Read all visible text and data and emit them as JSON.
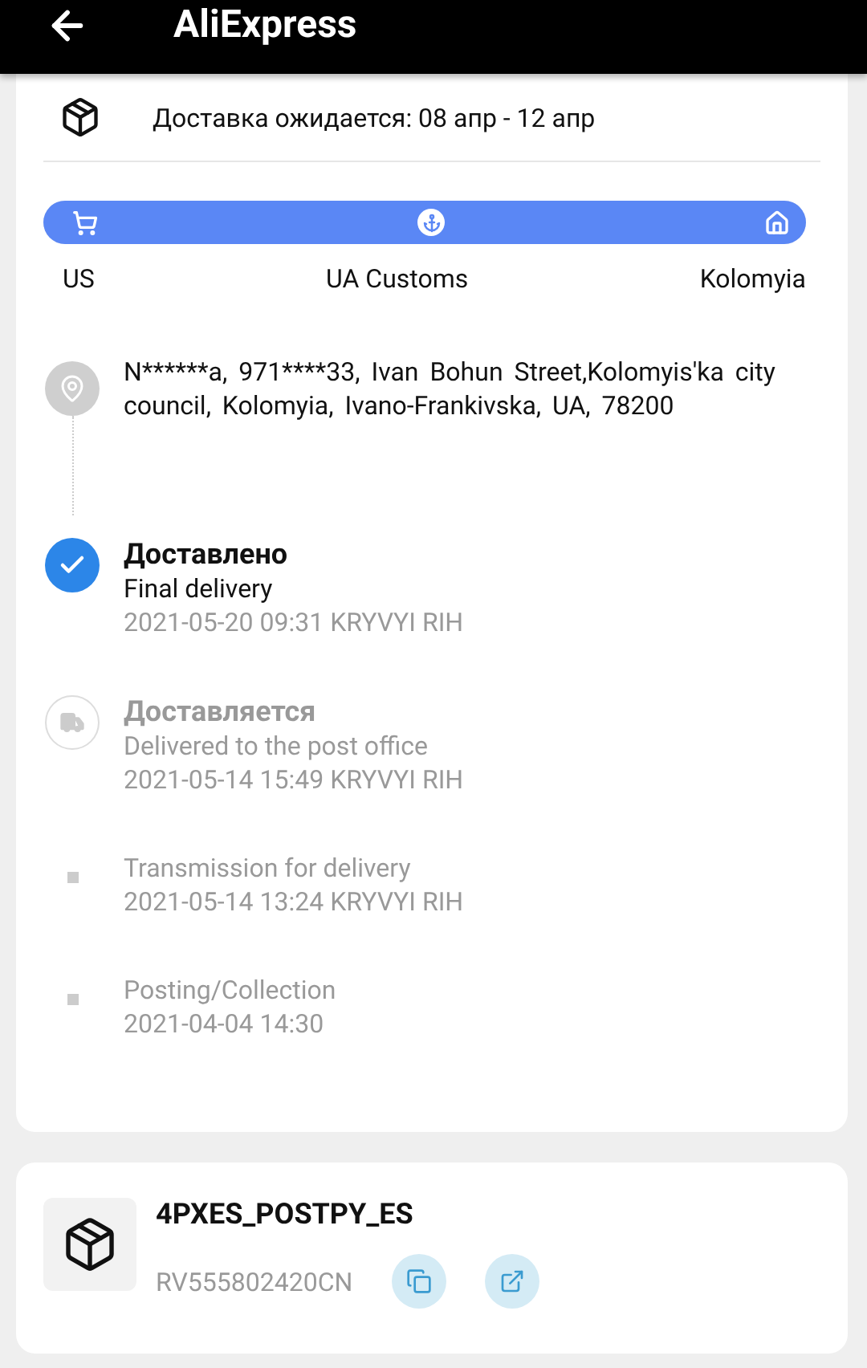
{
  "header": {
    "title": "AliExpress"
  },
  "estimate": {
    "text": "Доставка ожидается: 08 апр - 12 апр"
  },
  "route": {
    "level": 1,
    "stops": [
      {
        "kind": "cart",
        "label": "US"
      },
      {
        "kind": "anchor",
        "label": "UA Customs"
      },
      {
        "kind": "home",
        "label": "Kolomyia"
      }
    ]
  },
  "address": {
    "text": "N******a,  971****33,  Ivan Bohun Street,Kolomyis'ka city council,  Kolomyia,  Ivano-Frankivska,  UA,  78200"
  },
  "events": [
    {
      "kind": "delivered",
      "title": "Доставлено",
      "description": "Final delivery",
      "time": "2021-05-20 09:31 KRYVYI RIH"
    },
    {
      "kind": "truck",
      "title": "Доставляется",
      "description": "Delivered to the post office",
      "time": "2021-05-14 15:49 KRYVYI RIH"
    },
    {
      "kind": "dot",
      "description": "Transmission for delivery",
      "time": "2021-05-14 13:24 KRYVYI RIH"
    },
    {
      "kind": "dot",
      "description": "Posting/Collection",
      "time": "2021-04-04 14:30"
    }
  ],
  "carrier": {
    "name": "4PXES_POSTPY_ES",
    "tracking": "RV555802420CN"
  }
}
